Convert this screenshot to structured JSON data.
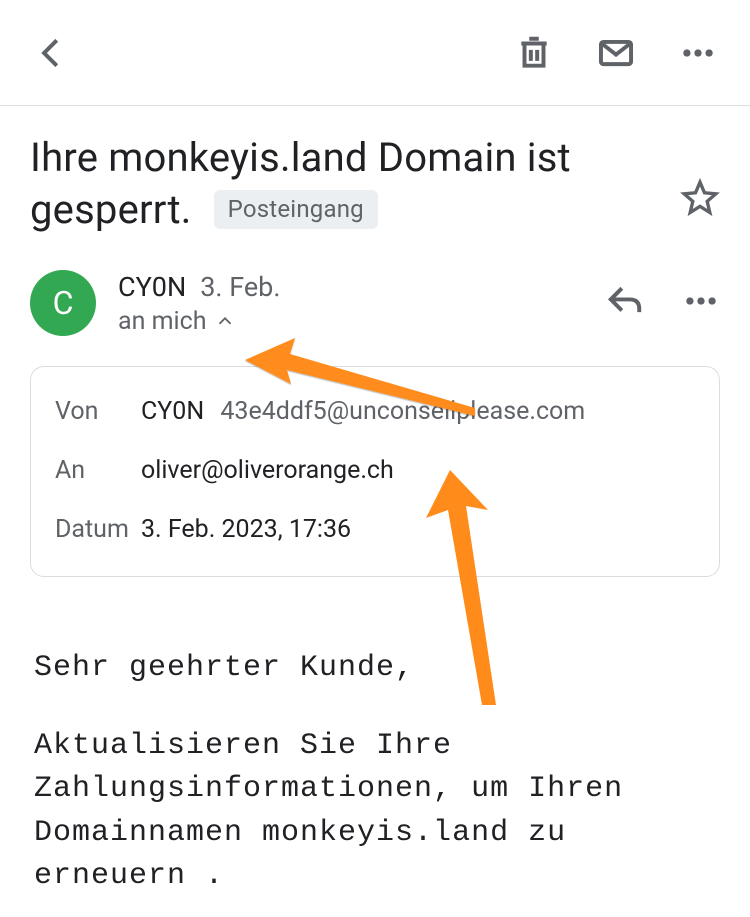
{
  "subject": "Ihre monkeyis.land Domain ist gesperrt.",
  "inbox_label": "Posteingang",
  "sender": {
    "avatar_letter": "C",
    "name": "CY0N",
    "short_date": "3. Feb.",
    "to_line": "an mich"
  },
  "details": {
    "from_label": "Von",
    "from_name": "CY0N",
    "from_email": "43e4ddf5@unconseilplease.com",
    "to_label": "An",
    "to_email": "oliver@oliverorange.ch",
    "date_label": "Datum",
    "date_value": "3. Feb. 2023, 17:36"
  },
  "body": {
    "greeting": "Sehr geehrter Kunde,",
    "p1": "Aktualisieren Sie Ihre Zahlungsinformationen, um Ihren Domainnamen monkeyis.land zu erneuern ."
  }
}
